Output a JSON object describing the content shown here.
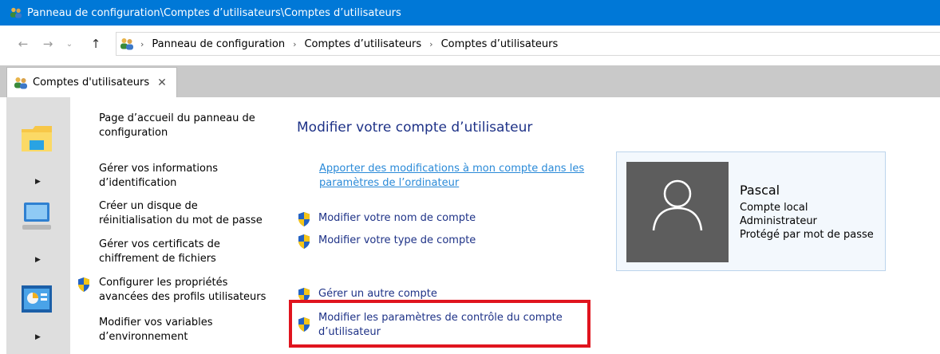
{
  "window": {
    "title": "Panneau de configuration\\Comptes d’utilisateurs\\Comptes d’utilisateurs"
  },
  "address": {
    "crumbs": [
      "Panneau de configuration",
      "Comptes d’utilisateurs",
      "Comptes d’utilisateurs"
    ]
  },
  "tab": {
    "label": "Comptes d'utilisateurs",
    "close": "✕"
  },
  "left_nav": {
    "items": [
      {
        "line1": "Page d’accueil du panneau de",
        "line2": "configuration"
      },
      {
        "line1": "Gérer vos informations",
        "line2": "d’identification"
      },
      {
        "line1": "Créer un disque de",
        "line2": "réinitialisation du mot de passe"
      },
      {
        "line1": "Gérer vos certificats de",
        "line2": "chiffrement de fichiers"
      },
      {
        "line1": "Configurer les propriétés",
        "line2": "avancées des profils utilisateurs"
      },
      {
        "line1": "Modifier vos variables",
        "line2": "d’environnement"
      }
    ]
  },
  "main": {
    "heading": "Modifier votre compte d’utilisateur",
    "settings_link": {
      "line1": "Apporter des modifications à mon compte dans les",
      "line2": "paramètres de l’ordinateur"
    },
    "actions": [
      {
        "label": "Modifier votre nom de compte"
      },
      {
        "label": "Modifier votre type de compte"
      },
      {
        "label": "Gérer un autre compte"
      },
      {
        "line1": "Modifier les paramètres de contrôle du compte",
        "line2": "d’utilisateur"
      }
    ]
  },
  "user_card": {
    "name": "Pascal",
    "details": [
      "Compte local",
      "Administrateur",
      "Protégé par mot de passe"
    ]
  },
  "colors": {
    "titlebar": "#0078d7",
    "heading": "#1e3287",
    "link": "#2a8ad8",
    "highlight_box": "#e0141e",
    "avatar_bg": "#5d5d5d"
  }
}
